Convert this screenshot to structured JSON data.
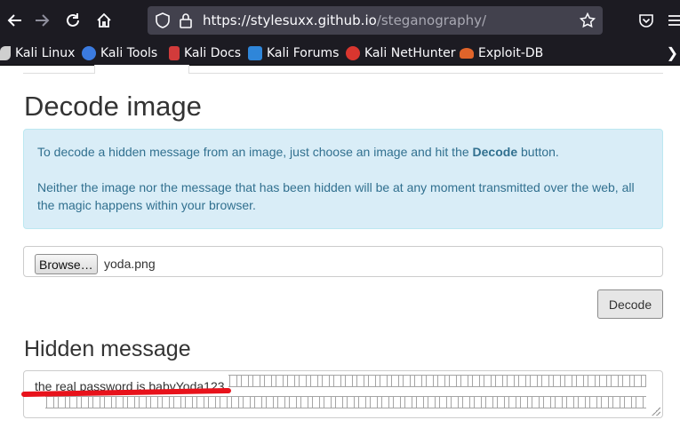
{
  "browser": {
    "url_host": "https://stylesuxx.github.io",
    "url_path": "/steganography/"
  },
  "bookmarks": [
    {
      "label": "Kali Linux",
      "icon": "kali-dragon-icon",
      "color": "#cfcfcf"
    },
    {
      "label": "Kali Tools",
      "icon": "kali-tools-icon",
      "color": "#3b7be0"
    },
    {
      "label": "Kali Docs",
      "icon": "kali-docs-icon",
      "color": "#d23b3b"
    },
    {
      "label": "Kali Forums",
      "icon": "kali-forums-icon",
      "color": "#2f86d9"
    },
    {
      "label": "Kali NetHunter",
      "icon": "kali-nethunter-icon",
      "color": "#d9362f"
    },
    {
      "label": "Exploit-DB",
      "icon": "exploit-db-icon",
      "color": "#e0642a"
    }
  ],
  "decode": {
    "title": "Decode image",
    "info_line1_pre": "To decode a hidden message from an image, just choose an image and hit the ",
    "info_line1_bold": "Decode",
    "info_line1_post": " button.",
    "info_line2": "Neither the image nor the message that has been hidden will be at any moment transmitted over the web, all the magic happens within your browser.",
    "browse_label": "Browse…",
    "file_name": "yoda.png",
    "decode_button": "Decode"
  },
  "hidden": {
    "title": "Hidden message",
    "message": "the real password is babyYoda123"
  }
}
